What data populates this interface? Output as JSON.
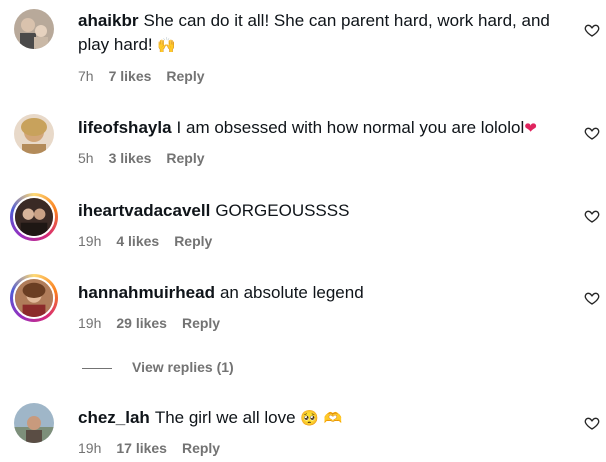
{
  "comments": [
    {
      "username": "ahaikbr",
      "text": "She can do it all! She can parent hard, work hard, and play hard!",
      "emoji": "🙌",
      "time": "7h",
      "likes": "7 likes",
      "reply": "Reply",
      "story_ring": false,
      "avatar_icon": "profile-photo"
    },
    {
      "username": "lifeofshayla",
      "text": "I am obsessed with how normal you are lololol",
      "emoji": "❤",
      "time": "5h",
      "likes": "3 likes",
      "reply": "Reply",
      "story_ring": false,
      "avatar_icon": "profile-photo"
    },
    {
      "username": "iheartvadacavell",
      "text": "GORGEOUSSSS",
      "emoji": "",
      "time": "19h",
      "likes": "4 likes",
      "reply": "Reply",
      "story_ring": true,
      "avatar_icon": "profile-photo"
    },
    {
      "username": "hannahmuirhead",
      "text": "an absolute legend",
      "emoji": "",
      "time": "19h",
      "likes": "29 likes",
      "reply": "Reply",
      "story_ring": true,
      "avatar_icon": "profile-photo"
    },
    {
      "username": "chez_lah",
      "text": "The girl we all love",
      "emoji": "🥺 🫶",
      "time": "19h",
      "likes": "17 likes",
      "reply": "Reply",
      "story_ring": false,
      "avatar_icon": "profile-photo"
    }
  ],
  "view_replies": "View replies (1)",
  "colors": {
    "text": "#0f1419",
    "meta": "#737373",
    "story_ring": "#d62976",
    "heart_red": "#e0245e"
  },
  "icons": {
    "like": "heart-outline-icon"
  }
}
